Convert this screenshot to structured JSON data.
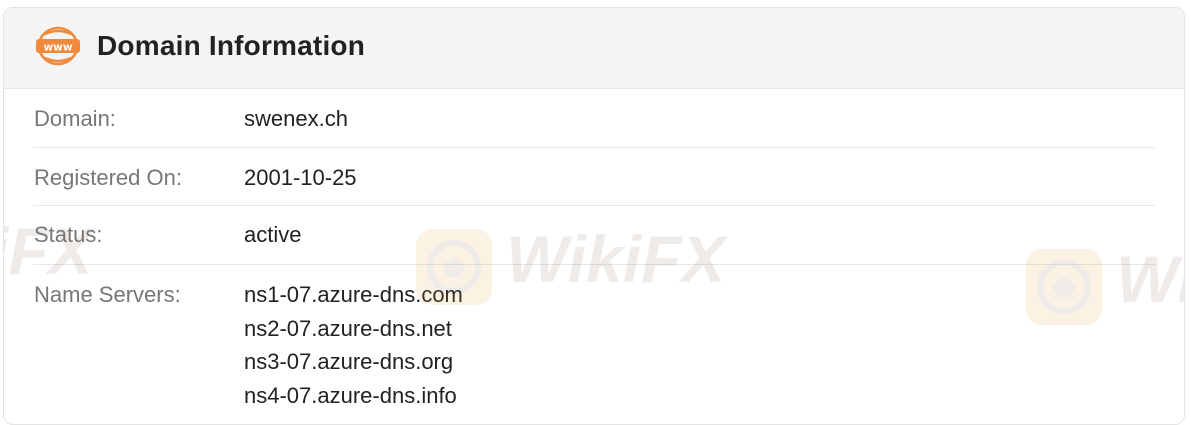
{
  "header": {
    "title": "Domain Information",
    "icon": "www-icon",
    "icon_text": "www",
    "accent_color": "#f08a3c"
  },
  "rows": [
    {
      "label": "Domain:",
      "value": "swenex.ch"
    },
    {
      "label": "Registered On:",
      "value": "2001-10-25"
    },
    {
      "label": "Status:",
      "value": "active"
    },
    {
      "label": "Name Servers:",
      "values": [
        "ns1-07.azure-dns.com",
        "ns2-07.azure-dns.net",
        "ns3-07.azure-dns.org",
        "ns4-07.azure-dns.info"
      ]
    }
  ],
  "watermark": {
    "text": "WikiFX",
    "text_left": "iFX",
    "text_right": "Wi"
  }
}
